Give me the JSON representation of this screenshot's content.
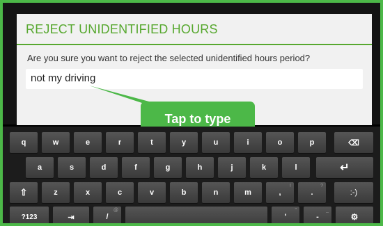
{
  "dialog": {
    "title": "REJECT UNIDENTIFIED HOURS",
    "message": "Are you sure you want to reject the selected unidentified hours period?",
    "input_value": "not my driving"
  },
  "tooltip": {
    "label": "Tap to type"
  },
  "keyboard": {
    "row1": [
      "q",
      "w",
      "e",
      "r",
      "t",
      "y",
      "u",
      "i",
      "o",
      "p",
      "⌫"
    ],
    "row2": [
      "a",
      "s",
      "d",
      "f",
      "g",
      "h",
      "j",
      "k",
      "l",
      "↵"
    ],
    "row3": [
      "⇧",
      "z",
      "x",
      "c",
      "v",
      "b",
      "n",
      "m",
      ",",
      ".",
      ":-)"
    ],
    "row4": [
      "?123",
      "⇥",
      "/",
      "",
      "'",
      "-",
      "⚙"
    ]
  },
  "colors": {
    "accent": "#4cb848",
    "title_green": "#57a82f"
  }
}
